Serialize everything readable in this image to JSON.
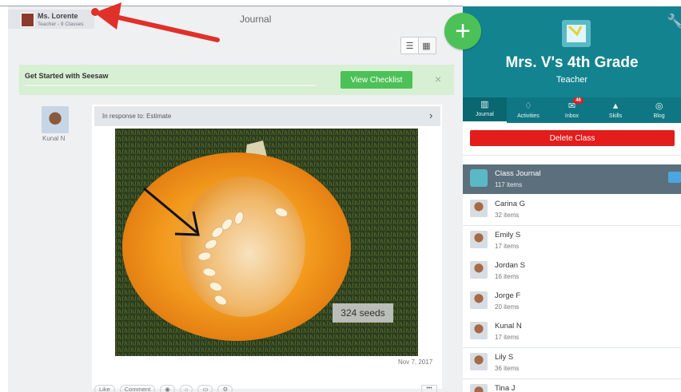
{
  "header": {
    "user_name": "Ms. Lorente",
    "user_subtitle": "Teacher - 9 Classes",
    "page_title": "Journal"
  },
  "banner": {
    "text": "Get Started with Seesaw",
    "button_label": "View Checklist",
    "close_icon": "×"
  },
  "post": {
    "author": "Kunal N",
    "in_response_to": "In response to: Estimate",
    "image_caption": "324 seeds",
    "date": "Nov 7, 2017",
    "actions": [
      "Like",
      "Comment"
    ]
  },
  "class_panel": {
    "class_name": "Mrs. V's 4th Grade",
    "role": "Teacher",
    "delete_label": "Delete Class",
    "tabs": [
      {
        "label": "Journal",
        "icon": "book-icon"
      },
      {
        "label": "Activities",
        "icon": "lightbulb-icon"
      },
      {
        "label": "Inbox",
        "icon": "chat-icon",
        "badge": "46"
      },
      {
        "label": "Skills",
        "icon": "graduation-cap-icon"
      },
      {
        "label": "Blog",
        "icon": "globe-icon"
      }
    ],
    "class_journal": {
      "name": "Class Journal",
      "count": "117 items"
    },
    "students": [
      {
        "name": "Carina G",
        "count": "32 items"
      },
      {
        "name": "Emily S",
        "count": "17 items"
      },
      {
        "name": "Jordan S",
        "count": "16 items"
      },
      {
        "name": "Jorge F",
        "count": "20 items"
      },
      {
        "name": "Kunal N",
        "count": "17 items"
      },
      {
        "name": "Lily S",
        "count": "36 items"
      },
      {
        "name": "Tina J",
        "count": ""
      }
    ]
  },
  "colors": {
    "teal": "#13838f",
    "green": "#4cc157",
    "red": "#e31c1c",
    "annotation_red": "#e0302a"
  }
}
